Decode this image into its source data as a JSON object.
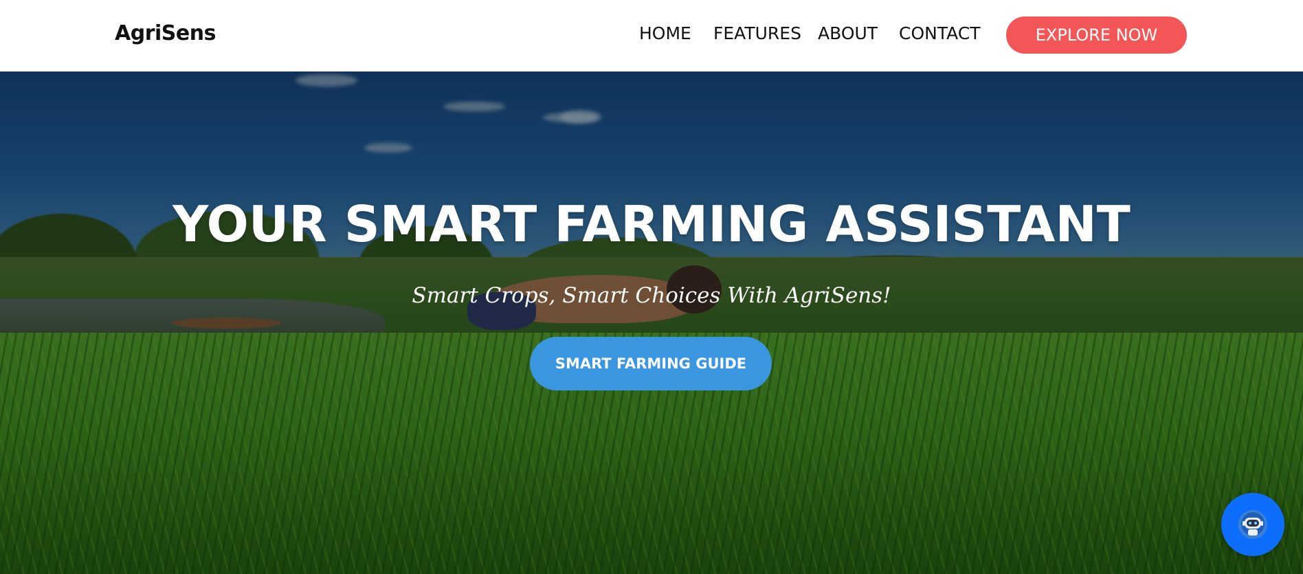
{
  "navbar": {
    "brand": "AgriSens",
    "links": [
      {
        "label": "HOME"
      },
      {
        "label": "FEATURES"
      },
      {
        "label": "ABOUT"
      },
      {
        "label": "CONTACT"
      }
    ],
    "cta_label": "EXPLORE NOW"
  },
  "hero": {
    "title": "YOUR SMART FARMING ASSISTANT",
    "subtitle": "Smart Crops, Smart Choices With AgriSens!",
    "button_label": "SMART FARMING GUIDE"
  },
  "chatbot": {
    "icon": "chatbot-robot-icon"
  },
  "colors": {
    "cta": "#f25656",
    "guide_button": "#3a96de",
    "chat_fab": "#0d6efd",
    "text_dark": "#111111"
  }
}
